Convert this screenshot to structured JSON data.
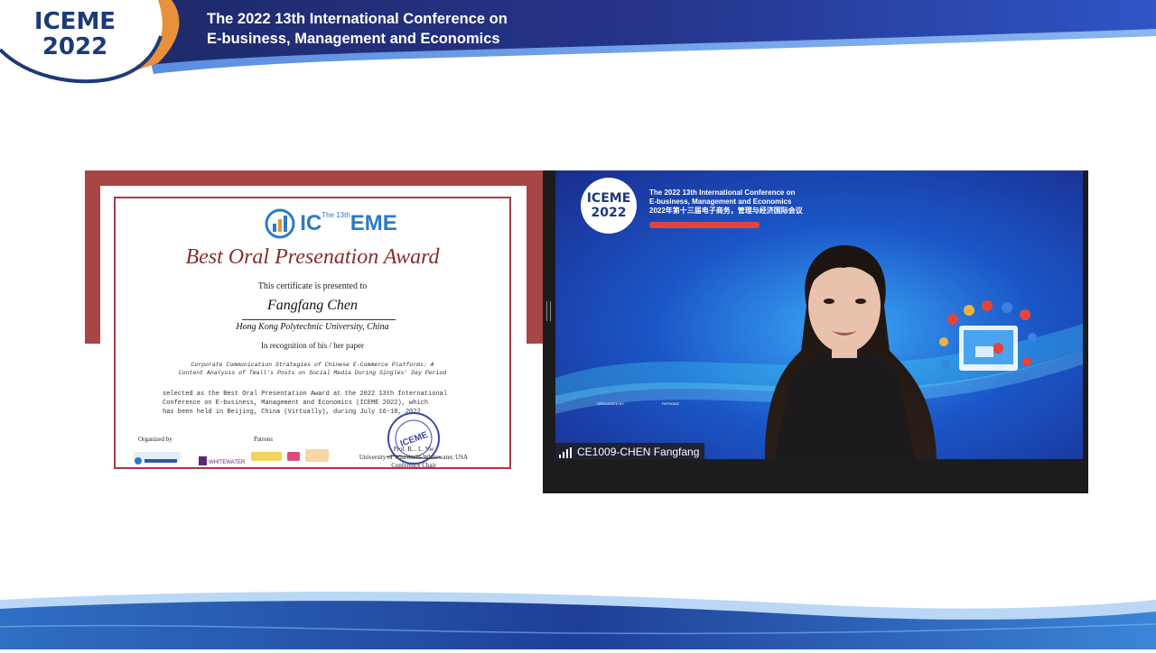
{
  "header": {
    "logo_line1": "ICEME",
    "logo_line2": "2022",
    "title_line1": "The 2022 13th International Conference on",
    "title_line2": "E-business, Management and Economics"
  },
  "certificate": {
    "logo_prefix": "IC",
    "logo_suffix": "EME",
    "logo_small": "The 13th",
    "award_title": "Best Oral Presenation Award",
    "presented_text": "This certificate is presented to",
    "recipient": "Fangfang Chen",
    "university": "Hong Kong Polytechnic University, China",
    "recognition": "In recognition of his / her paper",
    "paper_line1": "Corporate Communication Strategies of Chinese E-Commerce Platforms: A",
    "paper_line2": "Content Analysis of Tmall's Posts on Social Media During Singles' Day Period",
    "body_line1": "selected as the Best Oral Presentation Award at the 2022 13th International",
    "body_line2": "Conference on E-business, Management and Economics (ICEME 2022), which",
    "body_line3": "has been held in Beijing, China (Virtually), during July 16-18, 2022",
    "organized_by": "Organized by",
    "patrons": "Patrons",
    "signer_line1": "Prof. R... L. Yie",
    "signer_line2": "University of Wisconsin-Whitewater, USA",
    "signer_line3": "Conference Chair",
    "seal_text": "ICEME",
    "patron_logo_text": "WHITEWATER",
    "colors": {
      "maroon": "#a84545",
      "frame": "#a63a46",
      "award": "#8b2c2c"
    }
  },
  "video": {
    "logo_line1": "ICEME",
    "logo_line2": "2022",
    "conf_line1": "The 2022 13th International Conference on",
    "conf_line2": "E-business, Management and Economics",
    "conf_line3": "2022年第十三届电子商务，管理与经济国际会议",
    "organized_label": "ORGANIZED BY",
    "patrons_label": "PATRONS",
    "participant_name": "CE1009-CHEN Fangfang",
    "icon": "signal-bars-icon"
  }
}
